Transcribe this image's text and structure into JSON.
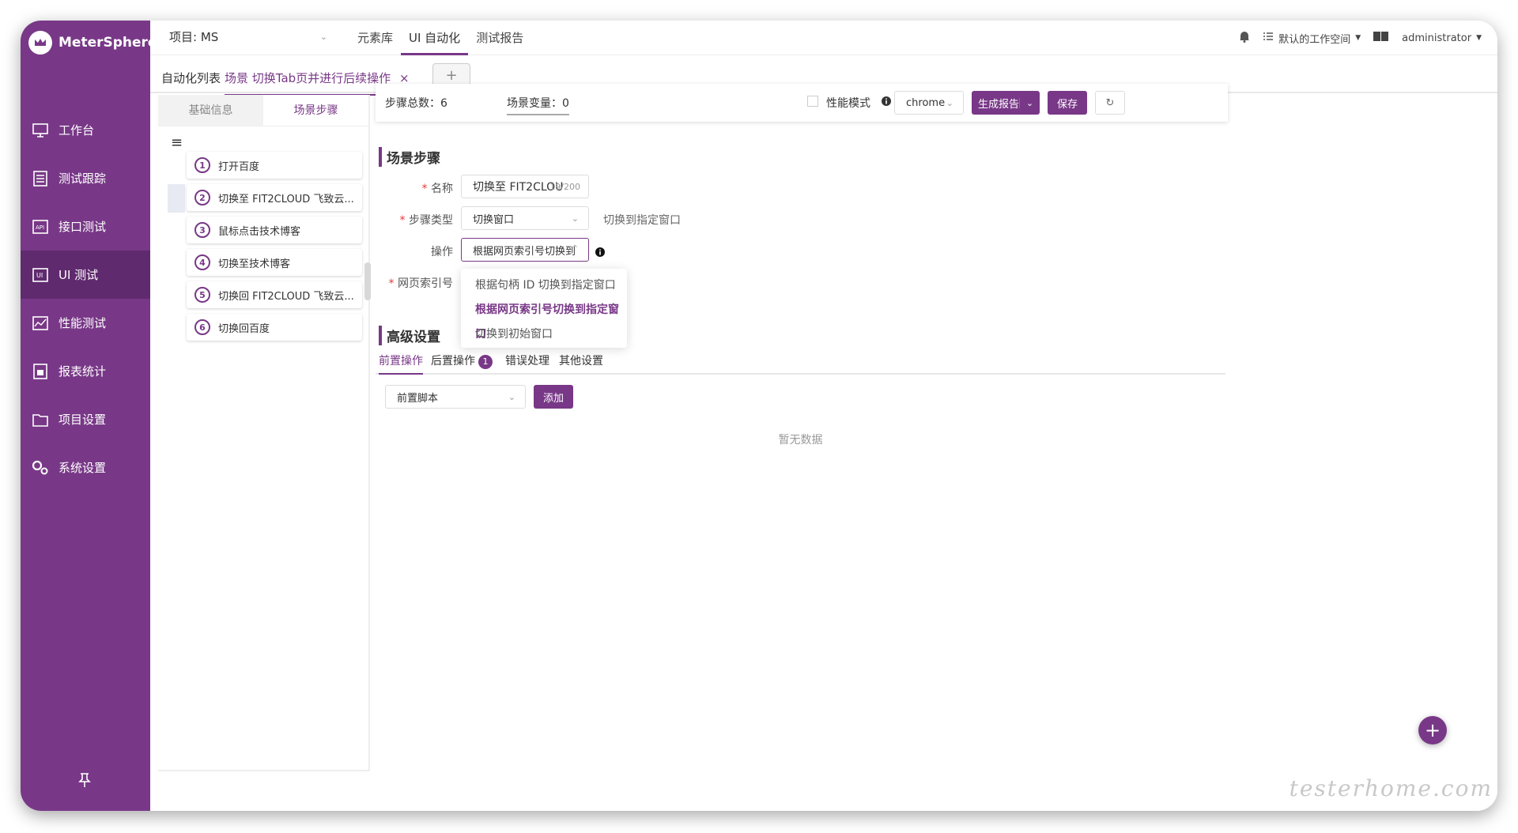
{
  "app": {
    "name": "MeterSphere"
  },
  "nav": [
    {
      "label": "工作台",
      "icon": "monitor-icon"
    },
    {
      "label": "测试跟踪",
      "icon": "checklist-icon"
    },
    {
      "label": "接口测试",
      "icon": "api-icon"
    },
    {
      "label": "UI 测试",
      "icon": "ui-icon",
      "active": true
    },
    {
      "label": "性能测试",
      "icon": "performance-icon"
    },
    {
      "label": "报表统计",
      "icon": "report-icon"
    },
    {
      "label": "项目设置",
      "icon": "project-icon"
    },
    {
      "label": "系统设置",
      "icon": "gear-icon"
    }
  ],
  "topbar": {
    "project": "项目: MS",
    "menus": [
      "元素库",
      "UI 自动化",
      "测试报告"
    ],
    "workspace": "默认的工作空间",
    "user": "administrator"
  },
  "tabs": {
    "list": "自动化列表",
    "current": "场景 切换Tab页并进行后续操作",
    "add": "+"
  },
  "left": {
    "tabs": [
      "基础信息",
      "场景步骤"
    ],
    "steps": [
      {
        "num": "1",
        "label": "打开百度"
      },
      {
        "num": "2",
        "label": "切换至 FIT2CLOUD 飞致云..."
      },
      {
        "num": "3",
        "label": "鼠标点击技术博客"
      },
      {
        "num": "4",
        "label": "切换至技术博客"
      },
      {
        "num": "5",
        "label": "切换回 FIT2CLOUD 飞致云..."
      },
      {
        "num": "6",
        "label": "切换回百度"
      }
    ]
  },
  "header": {
    "total": "步骤总数：6",
    "vars": "场景变量：0",
    "perf": "性能模式",
    "browser": "chrome",
    "report": "生成报告",
    "save": "保存"
  },
  "steps_section": {
    "title": "场景步骤",
    "name_label": "名称",
    "name_value": "切换至 FIT2CLOU",
    "name_count": "19/200",
    "type_label": "步骤类型",
    "type_value": "切换窗口",
    "type_hint": "切换到指定窗口",
    "op_label": "操作",
    "op_value": "根据网页索引号切换到",
    "index_label": "网页索引号"
  },
  "dropdown": [
    "根据句柄 ID 切换到指定窗口",
    "根据网页索引号切换到指定窗口",
    "切换到初始窗口"
  ],
  "advanced": {
    "title": "高级设置",
    "tabs": [
      "前置操作",
      "后置操作",
      "错误处理",
      "其他设置"
    ],
    "badge": "1",
    "script": "前置脚本",
    "add": "添加",
    "empty": "暂无数据"
  },
  "watermark": "testerhome.com"
}
